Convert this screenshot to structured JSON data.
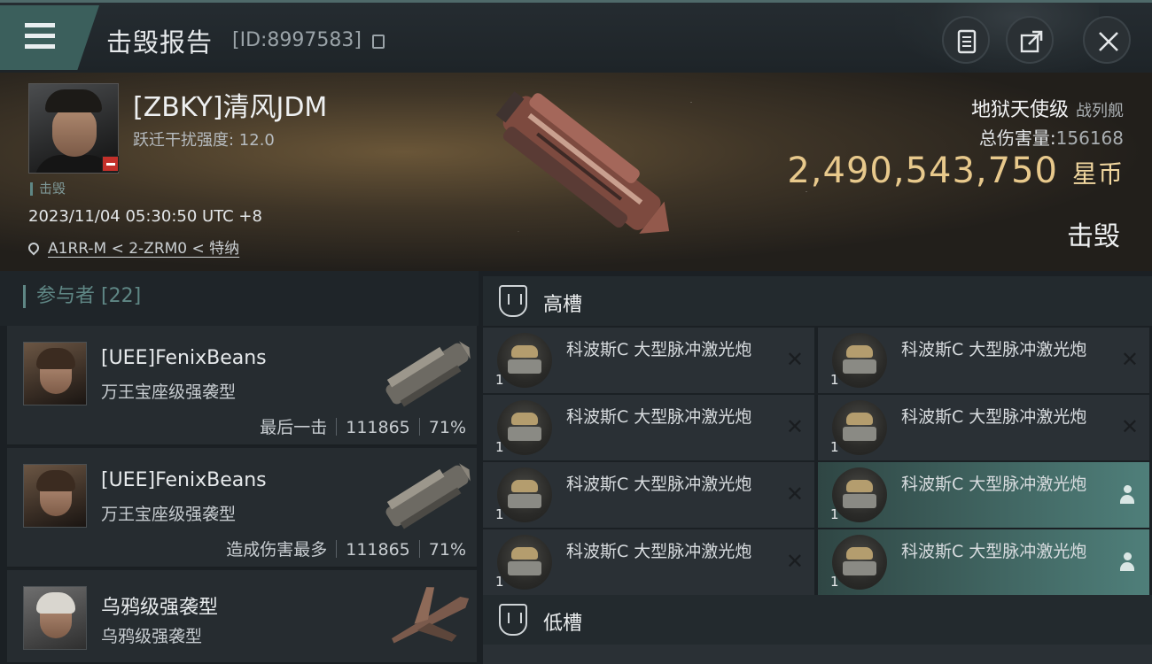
{
  "header": {
    "title": "击毁报告",
    "report_id": "[ID:8997583]"
  },
  "victim": {
    "name": "[ZBKY]清风JDM",
    "warp_label": "跃迁干扰强度: 12.0",
    "kill_tag": "击毁",
    "datetime": "2023/11/04 05:30:50 UTC +8",
    "location": "A1RR-M < 2-ZRM0 < 特纳",
    "ship_name": "地狱天使级",
    "ship_class": "战列舰",
    "damage_label": "总伤害量:",
    "damage_value": "156168",
    "isk_value": "2,490,543,750",
    "isk_currency": "星币",
    "status": "击毁"
  },
  "participants": {
    "label": "参与者 [22]",
    "rows": [
      {
        "name": "[UEE]FenixBeans",
        "ship": "万王宝座级强袭型",
        "role": "最后一击",
        "damage": "111865",
        "percent": "71%"
      },
      {
        "name": "[UEE]FenixBeans",
        "ship": "万王宝座级强袭型",
        "role": "造成伤害最多",
        "damage": "111865",
        "percent": "71%"
      },
      {
        "name": "乌鸦级强袭型",
        "ship": "乌鸦级强袭型",
        "role": "",
        "damage": "",
        "percent": ""
      }
    ]
  },
  "slots": {
    "high": {
      "label": "高槽",
      "modules": [
        {
          "name": "科波斯C 大型脉冲激光炮",
          "qty": "1",
          "state": "destroyed"
        },
        {
          "name": "科波斯C 大型脉冲激光炮",
          "qty": "1",
          "state": "destroyed"
        },
        {
          "name": "科波斯C 大型脉冲激光炮",
          "qty": "1",
          "state": "destroyed"
        },
        {
          "name": "科波斯C 大型脉冲激光炮",
          "qty": "1",
          "state": "destroyed"
        },
        {
          "name": "科波斯C 大型脉冲激光炮",
          "qty": "1",
          "state": "destroyed"
        },
        {
          "name": "科波斯C 大型脉冲激光炮",
          "qty": "1",
          "state": "dropped"
        },
        {
          "name": "科波斯C 大型脉冲激光炮",
          "qty": "1",
          "state": "destroyed"
        },
        {
          "name": "科波斯C 大型脉冲激光炮",
          "qty": "1",
          "state": "dropped"
        }
      ]
    },
    "low": {
      "label": "低槽"
    }
  },
  "icons": {
    "menu": "menu-icon",
    "clipboard": "clipboard-icon",
    "share": "share-icon",
    "close": "close-icon",
    "location": "location-pin-icon",
    "slot": "shield-slot-icon",
    "destroyed": "x-mark-icon",
    "dropped": "person-icon"
  },
  "colors": {
    "accent": "#5f8785",
    "isk": "#e8c98c",
    "highlight": "#4f7f7a",
    "danger": "#c3302a"
  }
}
